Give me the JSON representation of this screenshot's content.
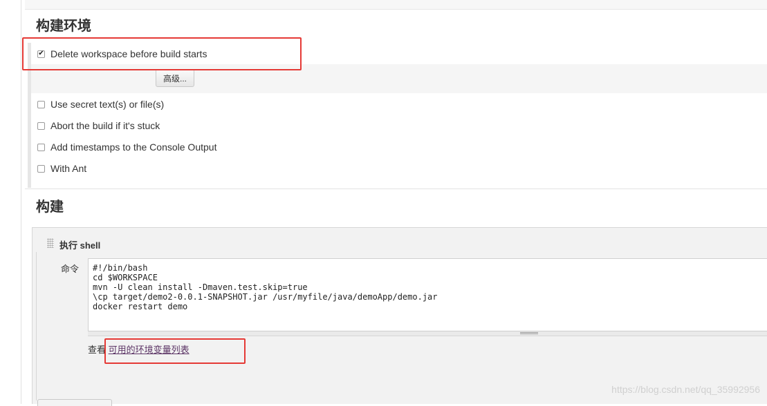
{
  "env_section": {
    "title": "构建环境",
    "options": [
      {
        "label": "Delete workspace before build starts",
        "checked": true
      },
      {
        "label": "Use secret text(s) or file(s)",
        "checked": false
      },
      {
        "label": "Abort the build if it's stuck",
        "checked": false
      },
      {
        "label": "Add timestamps to the Console Output",
        "checked": false
      },
      {
        "label": "With Ant",
        "checked": false
      }
    ],
    "advanced_button": "高级..."
  },
  "build_section": {
    "title": "构建",
    "step": {
      "title": "执行 shell",
      "command_label": "命令",
      "command": "#!/bin/bash\ncd $WORKSPACE\nmvn -U clean install -Dmaven.test.skip=true\n\\cp target/demo2-0.0.1-SNAPSHOT.jar /usr/myfile/java/demoApp/demo.jar\ndocker restart demo",
      "env_prefix": "查看",
      "env_link": "可用的环境变量列表"
    }
  },
  "watermark": "https://blog.csdn.net/qq_35992956",
  "colors": {
    "highlight": "#e53935",
    "link": "#5c3566"
  }
}
